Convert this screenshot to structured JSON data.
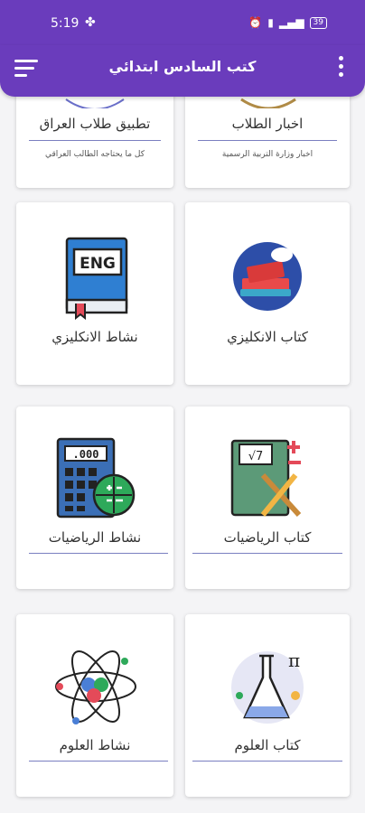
{
  "status": {
    "time": "5:19",
    "battery": "39"
  },
  "appbar": {
    "title": "كتب السادس ابتدائي"
  },
  "cards": [
    {
      "label": "تطبيق طلاب العراق",
      "subtitle": "كل ما يحتاجه الطالب العراقي"
    },
    {
      "label": "اخبار الطلاب",
      "subtitle": "اخبار وزارة التربية الرسمية"
    },
    {
      "label": "نشاط الانكليزي",
      "icon": "english-workbook-icon",
      "book_text": "ENG"
    },
    {
      "label": "كتاب الانكليزي",
      "icon": "english-book-stack-icon"
    },
    {
      "label": "نشاط الرياضيات",
      "icon": "calculator-icon",
      "display": ".000"
    },
    {
      "label": "كتاب الرياضيات",
      "icon": "math-book-icon"
    },
    {
      "label": "نشاط العلوم",
      "icon": "atom-icon"
    },
    {
      "label": "كتاب العلوم",
      "icon": "flask-icon",
      "symbol": "π"
    }
  ]
}
